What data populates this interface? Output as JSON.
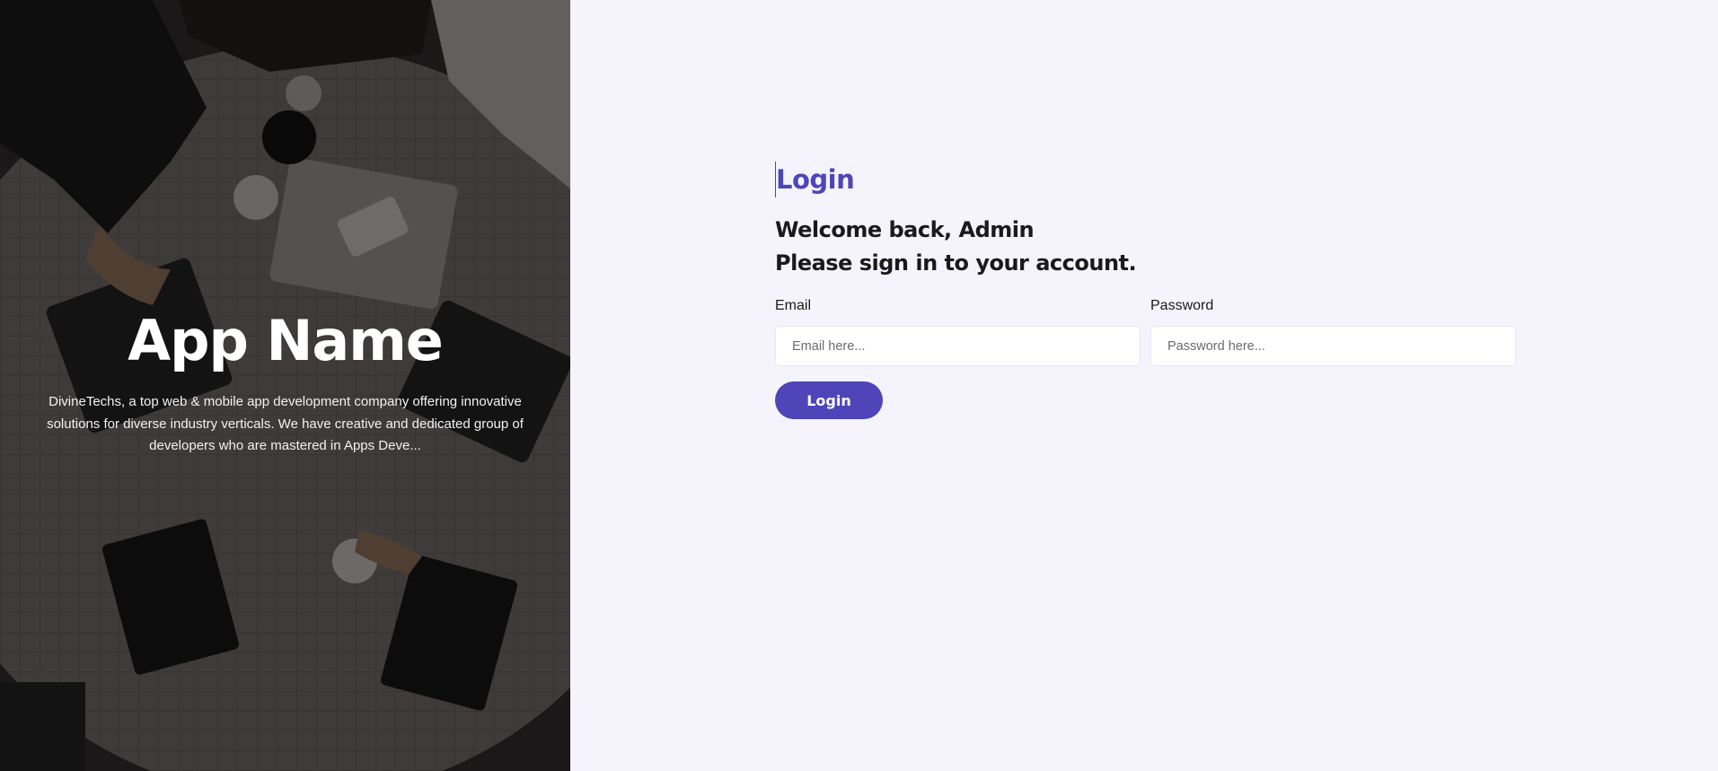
{
  "hero": {
    "title": "App Name",
    "description": "DivineTechs, a top web & mobile app development company offering innovative solutions for diverse industry verticals. We have creative and dedicated group of developers who are mastered in Apps Deve..."
  },
  "login": {
    "heading": "Login",
    "welcome_line1": "Welcome back, Admin",
    "welcome_line2": "Please sign in to your account.",
    "email": {
      "label": "Email",
      "placeholder": "Email here...",
      "value": ""
    },
    "password": {
      "label": "Password",
      "placeholder": "Password here...",
      "value": ""
    },
    "submit_label": "Login"
  },
  "colors": {
    "accent": "#4e45b8",
    "panel_bg": "#f5f4fd",
    "hero_overlay": "#000000"
  }
}
